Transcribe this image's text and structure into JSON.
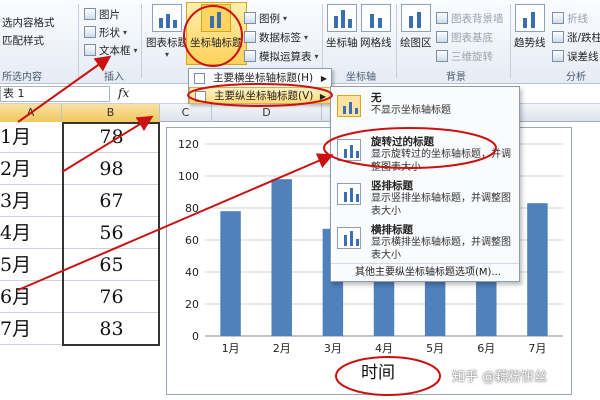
{
  "ribbon": {
    "left_items": [
      "选内容格式",
      "匹配样式"
    ],
    "left_group_label": "所选内容",
    "insert_items": [
      "图片",
      "形状",
      "文本框"
    ],
    "insert_group_label": "插入",
    "chart_title_btn": "图表标题",
    "axis_title_btn": "坐标轴标题",
    "legend_items": [
      "图例",
      "数据标签",
      "模拟运算表"
    ],
    "axis_group": {
      "axes_btn": "坐标轴",
      "gridlines_btn": "网格线",
      "label": "坐标轴"
    },
    "plot_area_btn": "绘图区",
    "background_items": [
      "图表背景墙",
      "图表基底",
      "三维旋转"
    ],
    "background_label": "背景",
    "trendline_btn": "趋势线",
    "analysis_items": [
      "折线",
      "涨/跌柱线",
      "误差线"
    ],
    "analysis_label": "分析"
  },
  "formula_bar": {
    "name_box": "表 1",
    "fx": "fx"
  },
  "columns": [
    "A",
    "B",
    "C",
    "D"
  ],
  "sheet_rows": [
    {
      "month": "1月",
      "value": "78"
    },
    {
      "month": "2月",
      "value": "98"
    },
    {
      "month": "3月",
      "value": "67"
    },
    {
      "month": "4月",
      "value": "56"
    },
    {
      "month": "5月",
      "value": "65"
    },
    {
      "month": "6月",
      "value": "76"
    },
    {
      "month": "7月",
      "value": "83"
    }
  ],
  "menu_level1": [
    {
      "label": "主要横坐标轴标题(H)"
    },
    {
      "label": "主要纵坐标轴标题(V)"
    }
  ],
  "menu_level2": {
    "items": [
      {
        "title": "无",
        "desc": "不显示坐标轴标题"
      },
      {
        "title": "旋转过的标题",
        "desc": "显示旋转过的坐标轴标题，并调整图表大小"
      },
      {
        "title": "竖排标题",
        "desc": "显示竖排坐标轴标题，并调整图表大小"
      },
      {
        "title": "横排标题",
        "desc": "显示横排坐标轴标题，并调整图表大小"
      }
    ],
    "more": "其他主要纵坐标轴标题选项(M)..."
  },
  "chart_data": {
    "type": "bar",
    "categories": [
      "1月",
      "2月",
      "3月",
      "4月",
      "5月",
      "6月",
      "7月"
    ],
    "values": [
      78,
      98,
      67,
      56,
      65,
      76,
      83
    ],
    "title": "",
    "xlabel": "时间",
    "ylabel": "",
    "ylim": [
      0,
      120
    ],
    "yticks": [
      0,
      20,
      40,
      60,
      80,
      100,
      120
    ],
    "grid": true,
    "bar_color": "#4f81bd"
  },
  "watermark": "知乎 @藕粉饼丝",
  "colors": {
    "annotation": "#cc1111",
    "highlight": "#ffd25a"
  }
}
